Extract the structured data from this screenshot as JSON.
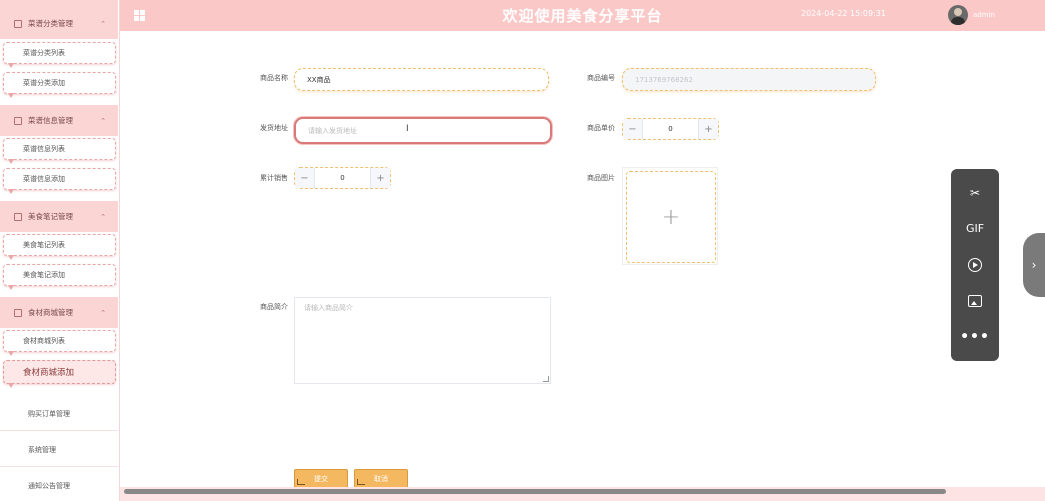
{
  "header": {
    "title": "欢迎使用美食分享平台",
    "datetime": "2024-04-22 15:09:31",
    "username": "admin",
    "menu_icon": "grid-icon",
    "avatar_icon": "user-avatar"
  },
  "sidebar": {
    "groups": [
      {
        "label": "菜谱分类管理",
        "items": [
          "菜谱分类列表",
          "菜谱分类添加"
        ]
      },
      {
        "label": "菜谱信息管理",
        "items": [
          "菜谱信息列表",
          "菜谱信息添加"
        ]
      },
      {
        "label": "美食笔记管理",
        "items": [
          "美食笔记列表",
          "美食笔记添加"
        ]
      },
      {
        "label": "食材商城管理",
        "items": [
          "食材商城列表",
          "食材商城添加"
        ]
      }
    ],
    "plain": [
      "购买订单管理",
      "系统管理",
      "通知公告管理"
    ],
    "active_item": "食材商城添加",
    "accent_color": "#fbd4d4"
  },
  "form": {
    "name_label": "商品名称",
    "name_value": "XX商品",
    "code_label": "商品编号",
    "code_value": "1713769768262",
    "address_label": "发货地址",
    "address_placeholder": "请输入发货地址",
    "price_label": "商品单价",
    "price_value": "0",
    "sales_label": "累计销售",
    "sales_value": "0",
    "image_label": "商品图片",
    "intro_label": "商品简介",
    "intro_placeholder": "请输入商品简介",
    "submit_label": "提交",
    "cancel_label": "取消",
    "field_border_color": "#f0c070"
  },
  "float_toolbar": {
    "icons": [
      "scissors-icon",
      "gif-icon",
      "play-circle-icon",
      "image-icon",
      "more-icon"
    ],
    "gif_text": "GIF"
  }
}
